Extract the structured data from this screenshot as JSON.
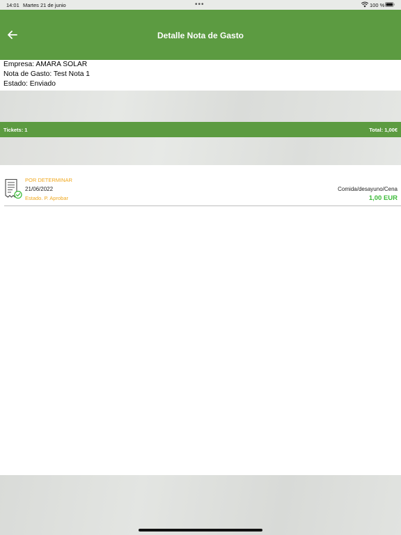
{
  "status_bar": {
    "time": "14:01",
    "date": "Martes 21 de junio",
    "battery": "100 %"
  },
  "header": {
    "title": "Detalle Nota de Gasto",
    "back_icon": "arrow-left-icon"
  },
  "info": {
    "empresa": "Empresa: AMARA SOLAR",
    "nota": "Nota de Gasto: Test Nota 1",
    "estado": "Estado: Enviado"
  },
  "summary": {
    "tickets": "Tickets: 1",
    "total": "Total: 1,00€"
  },
  "tickets": [
    {
      "project": "POR DETERMINAR",
      "date": "21/06/2022",
      "status": "Estado. P. Aprobar",
      "category": "Comida/desayuno/Cena",
      "amount": "1,00 EUR"
    }
  ],
  "colors": {
    "primary_green": "#5c9b41",
    "pending_orange": "#f0a81e",
    "amount_green": "#3dbb3a"
  }
}
